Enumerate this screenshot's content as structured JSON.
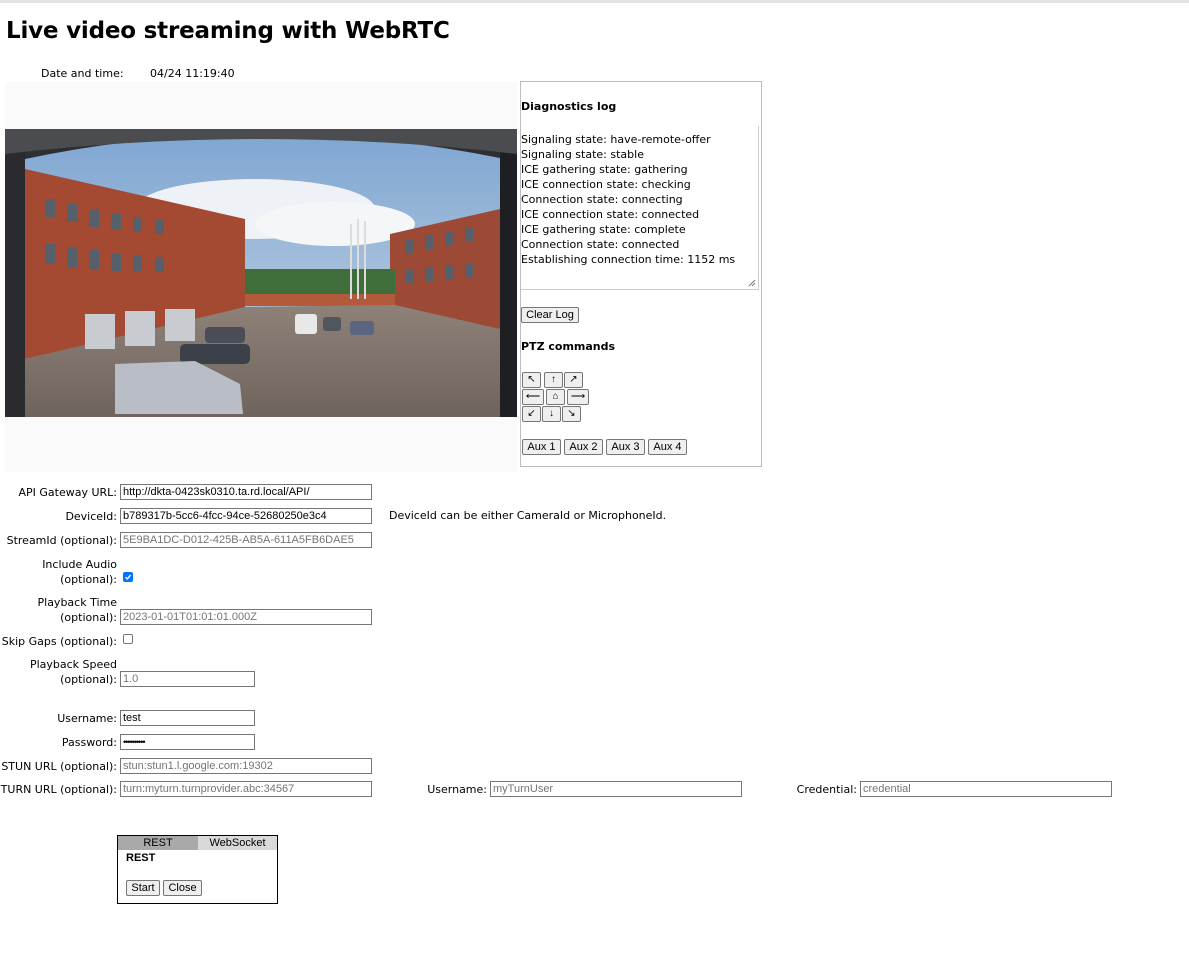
{
  "page": {
    "title": "Live video streaming with WebRTC",
    "datetime_label": "Date and time:",
    "datetime_value": "04/24 11:19:40"
  },
  "video": {
    "content": "courtyard camera view"
  },
  "diagnostics": {
    "title": "Diagnostics log",
    "log_lines": [
      "Signaling state: have-remote-offer",
      "Signaling state: stable",
      "ICE gathering state: gathering",
      "ICE connection state: checking",
      "Connection state: connecting",
      "ICE connection state: connected",
      "ICE gathering state: complete",
      "Connection state: connected",
      "Establishing connection time: 1152 ms"
    ],
    "clear_label": "Clear Log"
  },
  "ptz": {
    "title": "PTZ commands",
    "arrows": {
      "up_left": "↖",
      "up": "↑",
      "up_right": "↗",
      "left": "⟵",
      "home": "⌂",
      "right": "⟶",
      "down_left": "↙",
      "down": "↓",
      "down_right": "↘"
    },
    "aux": [
      "Aux 1",
      "Aux 2",
      "Aux 3",
      "Aux 4"
    ]
  },
  "form": {
    "api_gateway": {
      "label": "API Gateway URL:",
      "value": "http://dkta-0423sk0310.ta.rd.local/API/"
    },
    "device_id": {
      "label": "DeviceId:",
      "value": "b789317b-5cc6-4fcc-94ce-52680250e3c4",
      "note": "DeviceId can be either CameraId or MicrophoneId."
    },
    "stream_id": {
      "label": "StreamId (optional):",
      "placeholder": "5E9BA1DC-D012-425B-AB5A-611A5FB6DAE5"
    },
    "include_audio": {
      "label_line1": "Include Audio",
      "label_line2": "(optional):",
      "checked": true
    },
    "playback_time": {
      "label_line1": "Playback Time",
      "label_line2": "(optional):",
      "placeholder": "2023-01-01T01:01:01.000Z"
    },
    "skip_gaps": {
      "label": "Skip Gaps (optional):",
      "checked": false
    },
    "playback_speed": {
      "label_line1": "Playback Speed",
      "label_line2": "(optional):",
      "placeholder": "1.0"
    },
    "username": {
      "label": "Username:",
      "value": "test"
    },
    "password": {
      "label": "Password:",
      "value": "••••••••••"
    },
    "stun_url": {
      "label": "STUN URL (optional):",
      "placeholder": "stun:stun1.l.google.com:19302"
    },
    "turn_url": {
      "label": "TURN URL (optional):",
      "placeholder": "turn:myturn.turnprovider.abc:34567"
    },
    "turn_username": {
      "label": "Username:",
      "placeholder": "myTurnUser"
    },
    "turn_credential": {
      "label": "Credential:",
      "placeholder": "credential"
    }
  },
  "tabs": {
    "rest_label": "REST",
    "websocket_label": "WebSocket",
    "active_title": "REST",
    "start_label": "Start",
    "close_label": "Close"
  }
}
